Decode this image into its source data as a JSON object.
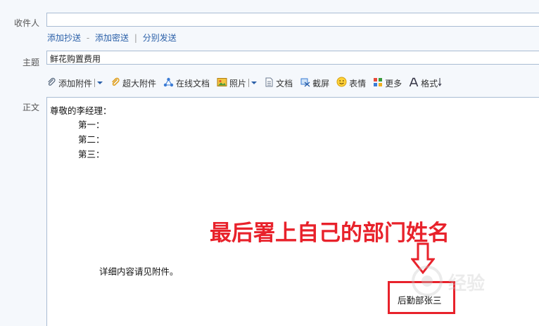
{
  "recipient": {
    "label": "收件人",
    "value": ""
  },
  "recipient_links": {
    "cc": "添加抄送",
    "bcc": "添加密送",
    "separate": "分别发送",
    "dash": "-",
    "bar": "|"
  },
  "subject": {
    "label": "主题",
    "value": "鲜花购置费用"
  },
  "toolbar": {
    "attach": "添加附件",
    "big_attach": "超大附件",
    "online_doc": "在线文档",
    "photo": "照片",
    "document": "文档",
    "screenshot": "截屏",
    "emoji": "表情",
    "more": "更多",
    "format": "格式"
  },
  "body": {
    "label": "正文",
    "lines": [
      "尊敬的李经理：",
      "第一：",
      "第二：",
      "第三：",
      "详细内容请见附件。"
    ],
    "signature": "后勤部张三"
  },
  "annotation": {
    "text": "最后署上自己的部门姓名",
    "color": "#e8222b"
  },
  "watermark": {
    "text": "经验"
  },
  "colors": {
    "link": "#2a5fa8",
    "border": "#a9bcd3",
    "background": "#f5f8fc",
    "highlight": "#e8222b"
  }
}
